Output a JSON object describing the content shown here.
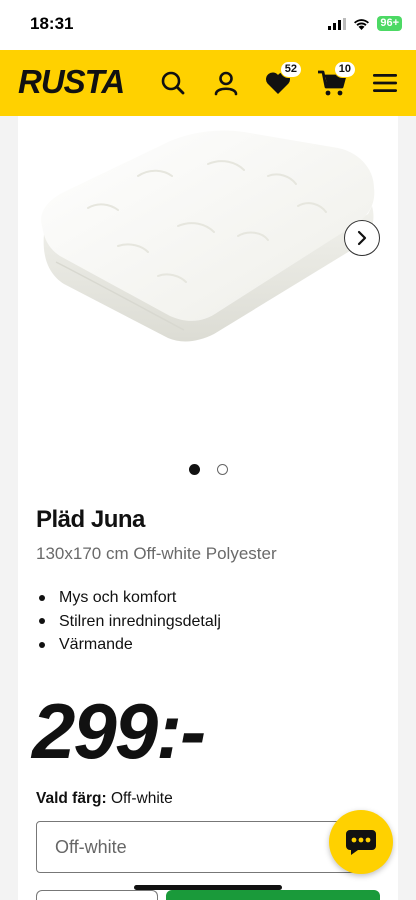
{
  "status_bar": {
    "time": "18:31",
    "battery": "96+"
  },
  "header": {
    "logo_text": "RUSTA",
    "favorites_count": "52",
    "cart_count": "10",
    "icons": [
      "search-icon",
      "account-icon",
      "heart-icon",
      "cart-icon",
      "menu-icon"
    ],
    "accent_color": "#ffd100"
  },
  "gallery": {
    "image": "white faux-fur blanket, folded",
    "slide": 1,
    "slide_count": 2
  },
  "product": {
    "title": "Pläd Juna",
    "subtitle": "130x170 cm Off-white Polyester",
    "features": [
      "Mys och komfort",
      "Stilren inredningsdetalj",
      "Värmande"
    ],
    "price": "299:-"
  },
  "color_selector": {
    "label": "Vald färg:",
    "selected_value": "Off-white",
    "field_value": "Off-white"
  },
  "buy_button_color": "#1a9a3a"
}
